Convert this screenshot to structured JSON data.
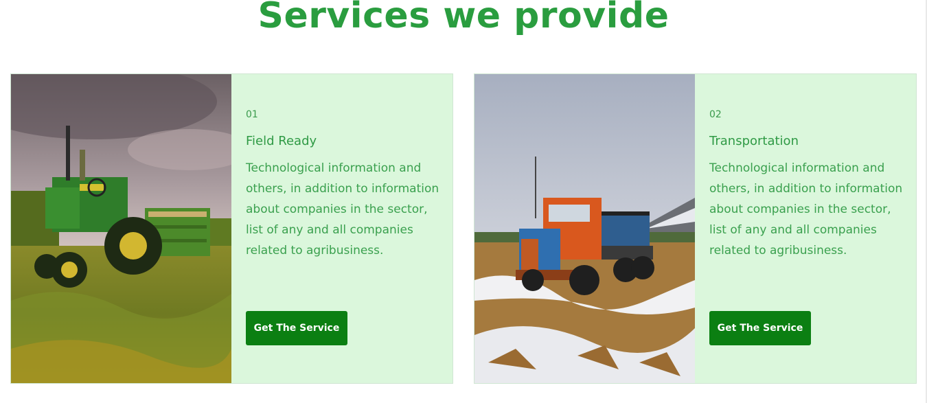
{
  "page": {
    "title": "Services we provide"
  },
  "services": [
    {
      "number": "01",
      "title": "Field Ready",
      "description": "Technological information and others, in addition to information about companies in the sector, list of any and all companies related to agribusiness.",
      "button_label": "Get The Service",
      "image": "green tractor in wheat field"
    },
    {
      "number": "02",
      "title": "Transportation",
      "description": "Technological information and others, in addition to information about companies in the sector, list of any and all companies related to agribusiness.",
      "button_label": "Get The Service",
      "image": "old orange truck in snowy field"
    }
  ],
  "colors": {
    "accent": "#2a9d3f",
    "card_bg": "#dbf7dc",
    "button_bg": "#0b7f12"
  }
}
